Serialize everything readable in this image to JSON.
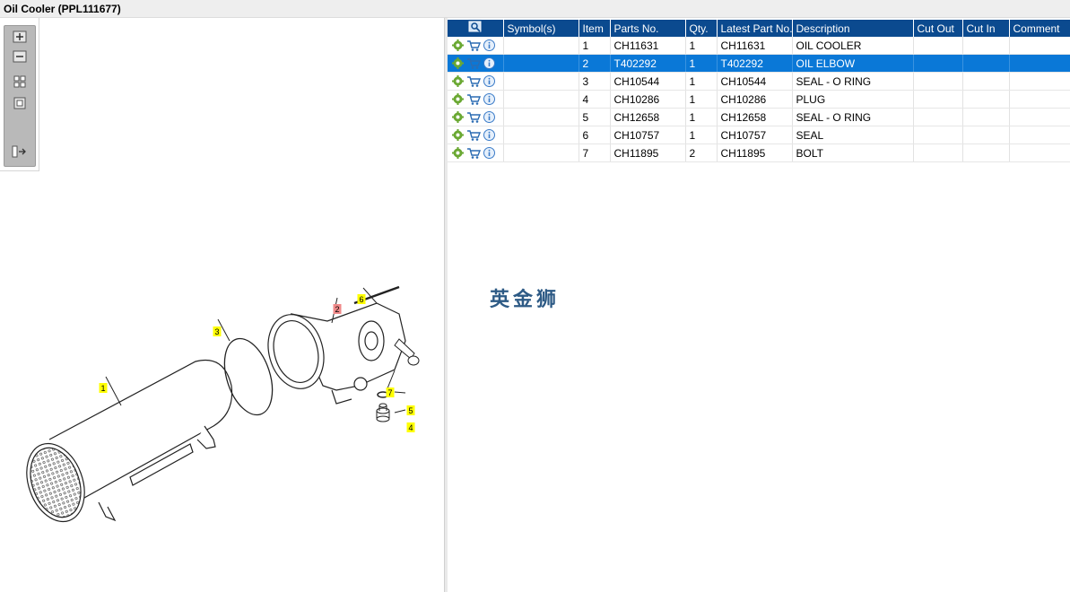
{
  "window": {
    "title": "Oil Cooler (PPL111677)"
  },
  "colors": {
    "header_bg": "#0b4a8f",
    "selected_row": "#0a78d7",
    "callout_yellow": "#ffff00",
    "callout_red": "#f08a8a"
  },
  "toolbar": {
    "buttons": [
      {
        "name": "zoom-in-icon"
      },
      {
        "name": "zoom-out-icon"
      },
      {
        "name": "fit-all-icon"
      },
      {
        "name": "actual-size-icon"
      },
      {
        "name": "toggle-list-icon"
      }
    ]
  },
  "callouts": [
    {
      "label": "1",
      "highlighted": false
    },
    {
      "label": "2",
      "highlighted": true
    },
    {
      "label": "3",
      "highlighted": false
    },
    {
      "label": "4",
      "highlighted": false
    },
    {
      "label": "5",
      "highlighted": false
    },
    {
      "label": "6",
      "highlighted": false
    },
    {
      "label": "7",
      "highlighted": false
    }
  ],
  "table": {
    "headers": [
      "",
      "Symbol(s)",
      "Item",
      "Parts No.",
      "Qty.",
      "Latest Part No.",
      "Description",
      "Cut Out",
      "Cut In",
      "Comment"
    ],
    "rows": [
      {
        "symbols": "",
        "item": "1",
        "part": "CH11631",
        "qty": "1",
        "latest": "CH11631",
        "desc": "OIL COOLER",
        "cut_out": "",
        "cut_in": "",
        "comment": ""
      },
      {
        "symbols": "",
        "item": "2",
        "part": "T402292",
        "qty": "1",
        "latest": "T402292",
        "desc": "OIL ELBOW",
        "cut_out": "",
        "cut_in": "",
        "comment": "",
        "selected": true
      },
      {
        "symbols": "",
        "item": "3",
        "part": "CH10544",
        "qty": "1",
        "latest": "CH10544",
        "desc": "SEAL - O RING",
        "cut_out": "",
        "cut_in": "",
        "comment": ""
      },
      {
        "symbols": "",
        "item": "4",
        "part": "CH10286",
        "qty": "1",
        "latest": "CH10286",
        "desc": "PLUG",
        "cut_out": "",
        "cut_in": "",
        "comment": ""
      },
      {
        "symbols": "",
        "item": "5",
        "part": "CH12658",
        "qty": "1",
        "latest": "CH12658",
        "desc": "SEAL - O RING",
        "cut_out": "",
        "cut_in": "",
        "comment": ""
      },
      {
        "symbols": "",
        "item": "6",
        "part": "CH10757",
        "qty": "1",
        "latest": "CH10757",
        "desc": "SEAL",
        "cut_out": "",
        "cut_in": "",
        "comment": ""
      },
      {
        "symbols": "",
        "item": "7",
        "part": "CH11895",
        "qty": "2",
        "latest": "CH11895",
        "desc": "BOLT",
        "cut_out": "",
        "cut_in": "",
        "comment": ""
      }
    ],
    "row_icons": [
      "gear-icon",
      "cart-icon",
      "info-icon"
    ]
  },
  "watermark": {
    "text": "英金狮"
  }
}
